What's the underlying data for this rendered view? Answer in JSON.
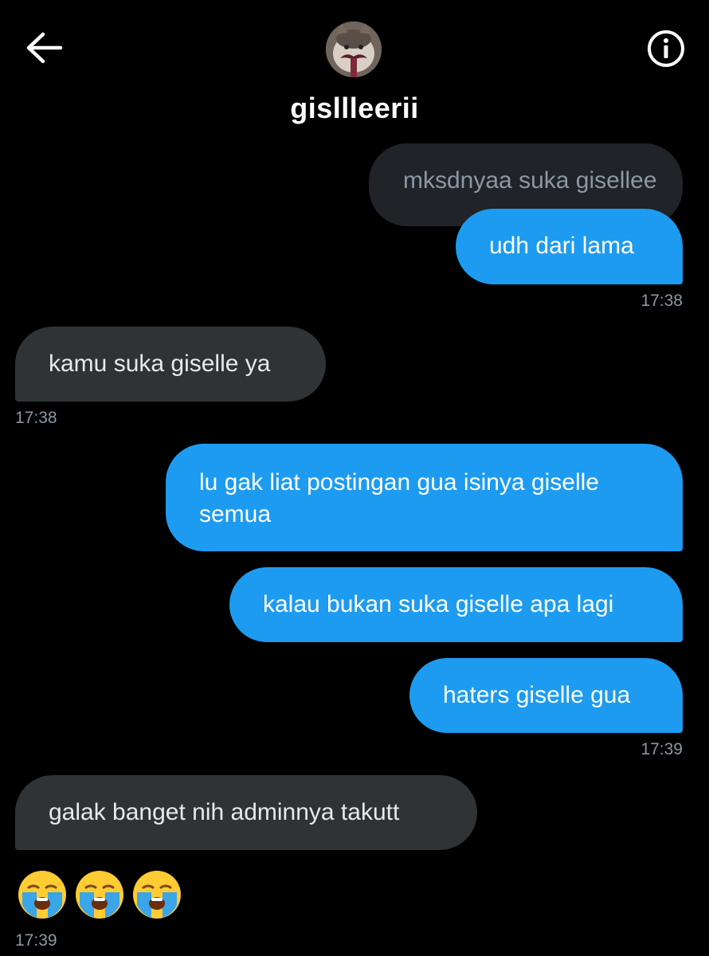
{
  "header": {
    "username": "gisllleerii",
    "back_icon": "arrow-left-icon",
    "info_icon": "info-circle-icon"
  },
  "messages": [
    {
      "type": "quoted",
      "text": "mksdnyaa suka gisellee"
    },
    {
      "type": "sent",
      "text": "udh dari lama"
    },
    {
      "type": "time",
      "text": "17:38"
    },
    {
      "type": "recv",
      "text": "kamu suka giselle ya"
    },
    {
      "type": "time",
      "text": "17:38"
    },
    {
      "type": "sent",
      "line1": "lu gak liat postingan gua isinya giselle",
      "line2": "semua"
    },
    {
      "type": "sent",
      "text": "kalau bukan suka giselle apa lagi"
    },
    {
      "type": "sent",
      "text": "haters giselle gua"
    },
    {
      "type": "time",
      "text": "17:39"
    },
    {
      "type": "recv",
      "text": "galak banget nih adminnya takutt"
    },
    {
      "type": "emoji",
      "icons": [
        "loudly-crying-face-emoji",
        "loudly-crying-face-emoji",
        "loudly-crying-face-emoji"
      ]
    },
    {
      "type": "time",
      "text": "17:39"
    }
  ],
  "colors": {
    "background": "#000000",
    "sent_bubble": "#1d9bf0",
    "received_bubble": "#2f3336",
    "quoted_bubble": "#202327",
    "timestamp": "#8b98a5"
  }
}
